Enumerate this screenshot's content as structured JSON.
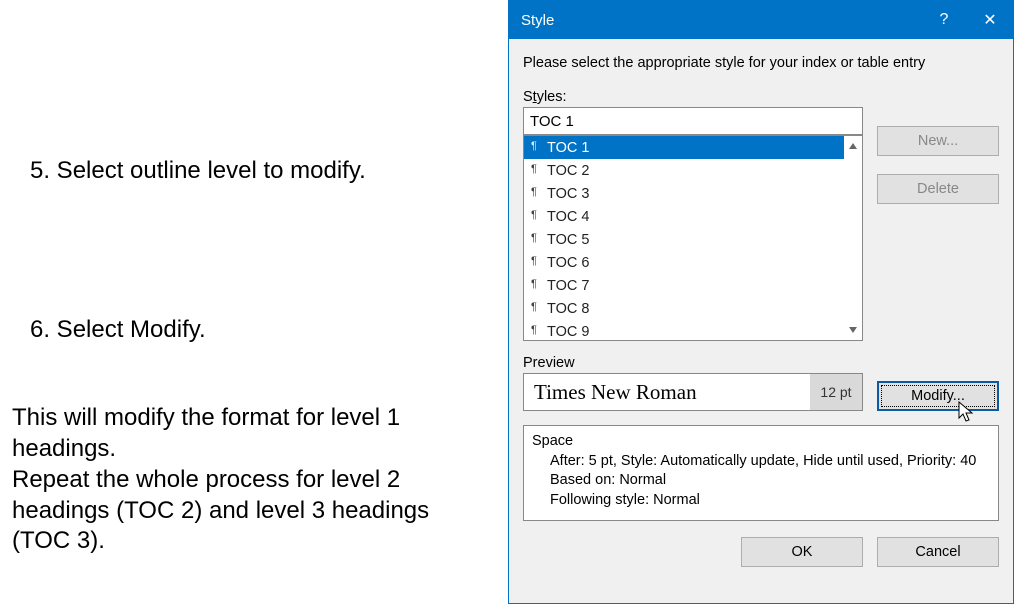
{
  "instructions": {
    "step5": "5. Select outline level to modify.",
    "step6": "6. Select Modify.",
    "para": "This will modify the format for level 1 headings.\nRepeat the whole process for level 2 headings (TOC 2) and level 3 headings (TOC 3)."
  },
  "dialog": {
    "title": "Style",
    "help_glyph": "?",
    "close_glyph": "✕",
    "intro": "Please select the appropriate style for your index or table entry",
    "styles_label_pre": "S",
    "styles_label_ul": "t",
    "styles_label_post": "yles:",
    "styles_input": "TOC 1",
    "styles": [
      {
        "label": "TOC 1",
        "selected": true
      },
      {
        "label": "TOC 2",
        "selected": false
      },
      {
        "label": "TOC 3",
        "selected": false
      },
      {
        "label": "TOC 4",
        "selected": false
      },
      {
        "label": "TOC 5",
        "selected": false
      },
      {
        "label": "TOC 6",
        "selected": false
      },
      {
        "label": "TOC 7",
        "selected": false
      },
      {
        "label": "TOC 8",
        "selected": false
      },
      {
        "label": "TOC 9",
        "selected": false
      }
    ],
    "new_btn": "New...",
    "delete_btn": "Delete",
    "preview_label": "Preview",
    "preview_font": "Times New Roman",
    "preview_pt": "12 pt",
    "modify_btn": "Modify...",
    "desc_heading": "Space",
    "desc_l1": "After:  5 pt, Style: Automatically update, Hide until used, Priority: 40",
    "desc_l2": "Based on: Normal",
    "desc_l3": "Following style: Normal",
    "ok_btn": "OK",
    "cancel_btn": "Cancel"
  }
}
